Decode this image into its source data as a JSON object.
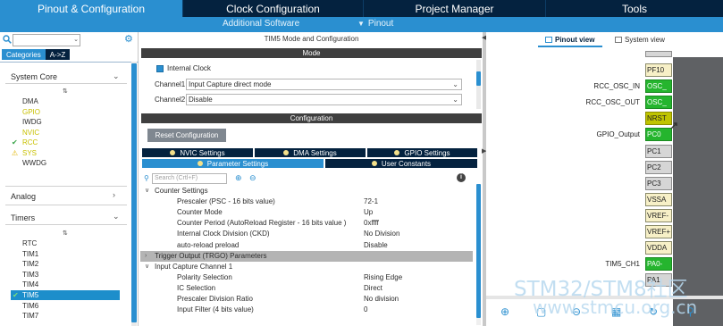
{
  "top_tabs": [
    "Pinout & Configuration",
    "Clock Configuration",
    "Project Manager",
    "Tools"
  ],
  "sub_bar": {
    "additional": "Additional Software",
    "pinout": "Pinout"
  },
  "left": {
    "seg_categories": "Categories",
    "seg_az": "A->Z",
    "group_system_core": "System Core",
    "system_core_items": [
      {
        "label": "DMA",
        "state": "normal"
      },
      {
        "label": "GPIO",
        "state": "yellow"
      },
      {
        "label": "IWDG",
        "state": "normal"
      },
      {
        "label": "NVIC",
        "state": "yellow"
      },
      {
        "label": "RCC",
        "state": "yellow-check"
      },
      {
        "label": "SYS",
        "state": "yellow-warn"
      },
      {
        "label": "WWDG",
        "state": "normal"
      }
    ],
    "group_analog": "Analog",
    "group_timers": "Timers",
    "timer_items": [
      "RTC",
      "TIM1",
      "TIM2",
      "TIM3",
      "TIM4",
      "TIM5",
      "TIM6",
      "TIM7"
    ],
    "selected_timer": "TIM5"
  },
  "mid": {
    "title": "TIM5 Mode and Configuration",
    "mode_bar": "Mode",
    "internal_clock": "Internal Clock",
    "channel1_label": "Channel1",
    "channel1_value": "Input Capture direct mode",
    "channel2_label": "Channel2",
    "channel2_value": "Disable",
    "config_bar": "Configuration",
    "reset_button": "Reset Configuration",
    "tabs": [
      "NVIC Settings",
      "DMA Settings",
      "GPIO Settings",
      "Parameter Settings",
      "User Constants"
    ],
    "search_placeholder": "Search (Crtl+F)",
    "params": [
      {
        "kind": "section",
        "name": "Counter Settings",
        "value": "",
        "open": true
      },
      {
        "kind": "item",
        "name": "Prescaler (PSC - 16 bits value)",
        "value": "72-1"
      },
      {
        "kind": "item",
        "name": "Counter Mode",
        "value": "Up"
      },
      {
        "kind": "item",
        "name": "Counter Period (AutoReload Register - 16 bits value )",
        "value": "0xffff"
      },
      {
        "kind": "item",
        "name": "Internal Clock Division (CKD)",
        "value": "No Division"
      },
      {
        "kind": "item",
        "name": "auto-reload preload",
        "value": "Disable"
      },
      {
        "kind": "section",
        "name": "Trigger Output (TRGO) Parameters",
        "value": "",
        "open": false
      },
      {
        "kind": "section",
        "name": "Input Capture Channel 1",
        "value": "",
        "open": true
      },
      {
        "kind": "item",
        "name": "Polarity Selection",
        "value": "Rising Edge"
      },
      {
        "kind": "item",
        "name": "IC Selection",
        "value": "Direct"
      },
      {
        "kind": "item",
        "name": "Prescaler Division Ratio",
        "value": "No division"
      },
      {
        "kind": "item",
        "name": "Input Filter (4 bits value)",
        "value": "0"
      }
    ]
  },
  "right": {
    "pinout_view": "Pinout view",
    "system_view": "System view",
    "pins": [
      {
        "pin": "PF10",
        "label": "",
        "color": "yellow"
      },
      {
        "pin": "OSC_",
        "label": "RCC_OSC_IN",
        "color": "green"
      },
      {
        "pin": "OSC_",
        "label": "RCC_OSC_OUT",
        "color": "green"
      },
      {
        "pin": "NRST",
        "label": "",
        "color": "olive"
      },
      {
        "pin": "PC0",
        "label": "GPIO_Output",
        "color": "green"
      },
      {
        "pin": "PC1",
        "label": "",
        "color": "grey"
      },
      {
        "pin": "PC2",
        "label": "",
        "color": "grey"
      },
      {
        "pin": "PC3",
        "label": "",
        "color": "grey"
      },
      {
        "pin": "VSSA",
        "label": "",
        "color": "yellow"
      },
      {
        "pin": "VREF-",
        "label": "",
        "color": "yellow"
      },
      {
        "pin": "VREF+",
        "label": "",
        "color": "yellow"
      },
      {
        "pin": "VDDA",
        "label": "",
        "color": "yellow"
      },
      {
        "pin": "PA0-",
        "label": "TIM5_CH1",
        "color": "green"
      },
      {
        "pin": "PA1",
        "label": "",
        "color": "grey"
      }
    ]
  },
  "watermark": {
    "line1": "STM32/STM8社区",
    "line2": "www.stmcu.org.cn"
  },
  "colors": {
    "nav_dark": "#04223f",
    "accent": "#2a8fd0",
    "pin_green": "#25b52e",
    "pin_yellow": "#f7f0c7"
  }
}
